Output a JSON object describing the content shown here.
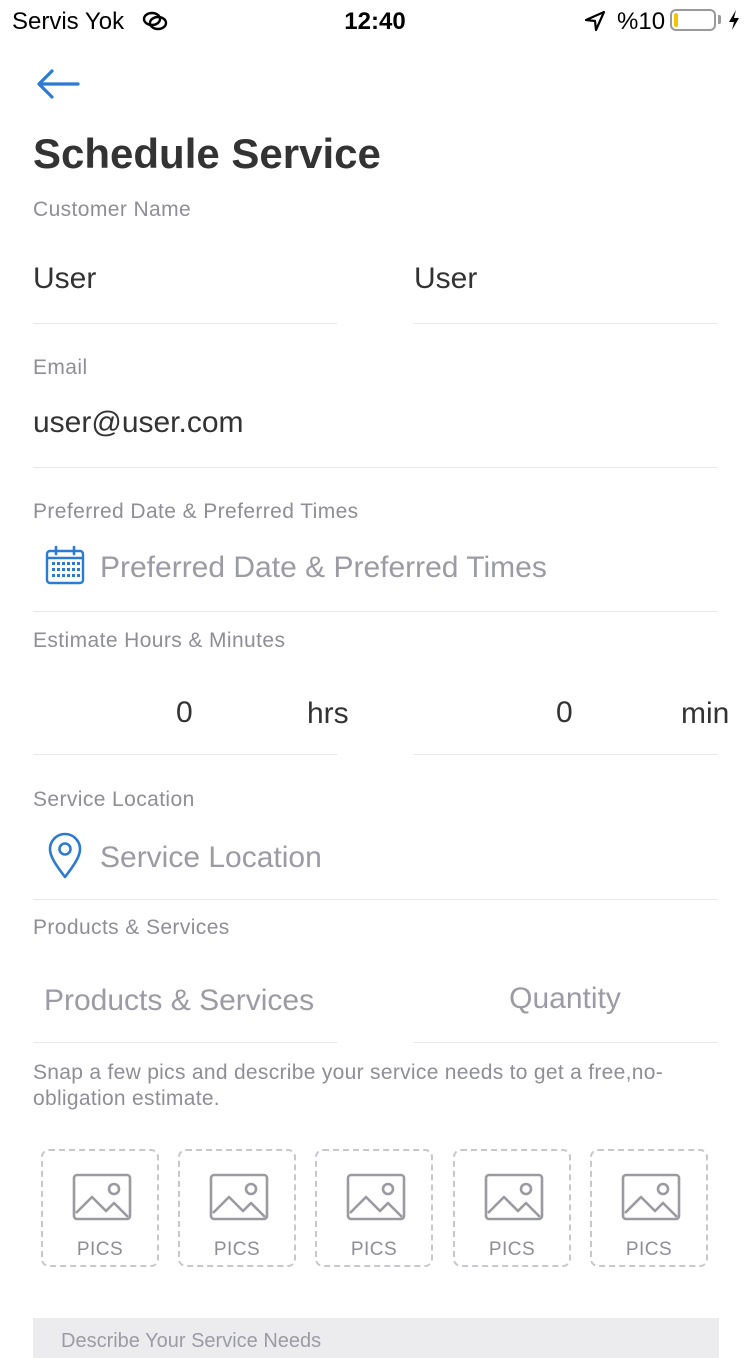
{
  "status_bar": {
    "carrier": "Servis Yok",
    "time": "12:40",
    "battery_text": "%10",
    "battery_level": 0.1,
    "battery_color": "#f2c500"
  },
  "header": {
    "back_icon": "arrow-left-icon",
    "title": "Schedule Service"
  },
  "customer_name": {
    "label": "Customer Name",
    "first_name": "User",
    "last_name": "User"
  },
  "email": {
    "label": "Email",
    "value": "user@user.com"
  },
  "preferred_date": {
    "label": "Preferred Date & Preferred Times",
    "icon": "calendar-icon",
    "placeholder": "Preferred Date & Preferred Times"
  },
  "estimate": {
    "label": "Estimate Hours & Minutes",
    "hours_value": "0",
    "hours_unit": "hrs",
    "minutes_value": "0",
    "minutes_unit": "min"
  },
  "service_location": {
    "label": "Service Location",
    "icon": "location-pin-icon",
    "placeholder": "Service Location"
  },
  "products": {
    "label": "Products & Services",
    "product_placeholder": "Products & Services",
    "quantity_placeholder": "Quantity"
  },
  "instructions": "Snap a few pics and describe your service needs to get a free,no-obligation estimate.",
  "pics": [
    {
      "label": "PICS",
      "icon": "image-icon"
    },
    {
      "label": "PICS",
      "icon": "image-icon"
    },
    {
      "label": "PICS",
      "icon": "image-icon"
    },
    {
      "label": "PICS",
      "icon": "image-icon"
    },
    {
      "label": "PICS",
      "icon": "image-icon"
    }
  ],
  "description": {
    "placeholder": "Describe Your Service Needs"
  },
  "colors": {
    "accent": "#2a7bd1",
    "label": "#8e8e96",
    "placeholder": "#9b9ba5",
    "divider": "#e8e8ec"
  }
}
